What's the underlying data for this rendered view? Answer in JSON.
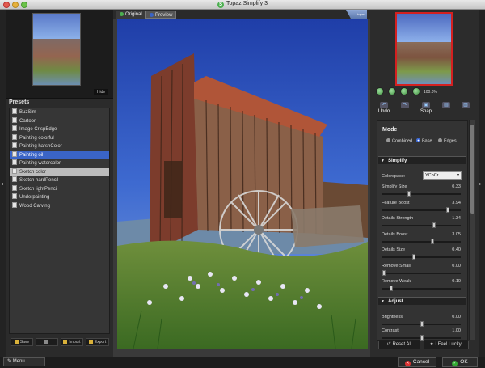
{
  "window": {
    "title": "Topaz Simplify 3",
    "logo_glyph": "S"
  },
  "left_panel": {
    "hide_label": "Hide",
    "presets_title": "Presets",
    "presets": [
      {
        "label": "BuzSim",
        "state": "normal"
      },
      {
        "label": "Cartoon",
        "state": "normal"
      },
      {
        "label": "Image CrispEdge",
        "state": "normal"
      },
      {
        "label": "Painting colorful",
        "state": "normal"
      },
      {
        "label": "Painting harshColor",
        "state": "normal"
      },
      {
        "label": "Painting oil",
        "state": "selected"
      },
      {
        "label": "Painting watercolor",
        "state": "normal"
      },
      {
        "label": "Sketch color",
        "state": "hover"
      },
      {
        "label": "Sketch hardPencil",
        "state": "normal"
      },
      {
        "label": "Sketch lightPencil",
        "state": "normal"
      },
      {
        "label": "Underpainting",
        "state": "normal"
      },
      {
        "label": "Wood Carving",
        "state": "normal"
      }
    ],
    "buttons": {
      "save": "Save",
      "blank": "",
      "import": "Import",
      "export": "Export"
    }
  },
  "center": {
    "tabs": {
      "original": "Original",
      "preview": "Preview"
    },
    "active_tab": "Preview",
    "logo_text": "topaz",
    "colors": {
      "original_dot": "#4caf50",
      "preview_dot": "#3a64c6"
    }
  },
  "right_panel": {
    "zoom_percent": "100.0%",
    "tools": {
      "undo": "Undo",
      "redo": "",
      "snap": "Snap",
      "compare1": "",
      "compare2": ""
    },
    "mode": {
      "title": "Mode",
      "options": [
        "Combined",
        "Base",
        "Edges"
      ],
      "selected": "Base"
    },
    "simplify": {
      "title": "Simplify",
      "colorspace_label": "Colorspace:",
      "colorspace_value": "YCbCr",
      "sliders": [
        {
          "label": "Simplify Size",
          "value": "0.33",
          "fraction": 0.33
        },
        {
          "label": "Feature Boost",
          "value": "3.94",
          "fraction": 0.85
        },
        {
          "label": "Details Strength",
          "value": "1.34",
          "fraction": 0.67
        },
        {
          "label": "Details Boost",
          "value": "3.05",
          "fraction": 0.65
        },
        {
          "label": "Details Size",
          "value": "0.40",
          "fraction": 0.4
        },
        {
          "label": "Remove Small",
          "value": "0.00",
          "fraction": 0.0
        },
        {
          "label": "Remove Weak",
          "value": "0.10",
          "fraction": 0.1
        }
      ]
    },
    "adjust": {
      "title": "Adjust",
      "sliders": [
        {
          "label": "Brightness",
          "value": "0.00",
          "fraction": 0.5
        },
        {
          "label": "Contrast",
          "value": "1.00",
          "fraction": 0.5
        }
      ]
    },
    "reset_all": "Reset All",
    "feel_lucky": "I Feel Lucky!"
  },
  "bottom": {
    "menu": "Menu...",
    "cancel": "Cancel",
    "ok": "OK"
  },
  "side_handles": {
    "left_glyph": "◂",
    "right_glyph": "▸"
  }
}
